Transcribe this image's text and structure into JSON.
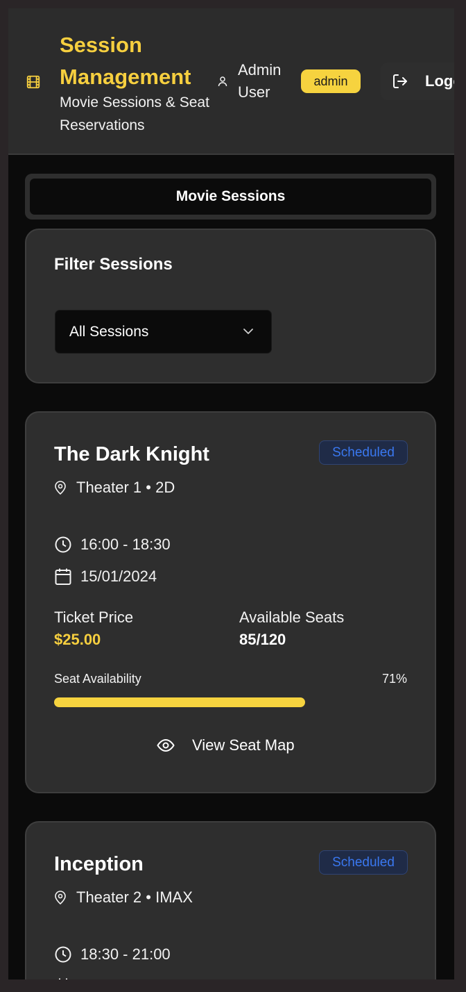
{
  "header": {
    "title": "Session Management",
    "subtitle": "Movie Sessions & Seat Reservations",
    "user_name": "Admin User",
    "role_badge": "admin",
    "logout_label": "Logout"
  },
  "tabs": [
    {
      "label": "Movie Sessions",
      "active": true
    }
  ],
  "filter": {
    "title": "Filter Sessions",
    "selected": "All Sessions"
  },
  "sessions": [
    {
      "title": "The Dark Knight",
      "status": "Scheduled",
      "location": "Theater 1 • 2D",
      "time": "16:00 - 18:30",
      "date": "15/01/2024",
      "price_label": "Ticket Price",
      "price": "$25.00",
      "seats_label": "Available Seats",
      "seats": "85/120",
      "availability_label": "Seat Availability",
      "availability_pct": "71%",
      "availability_fraction": 0.71,
      "view_label": "View Seat Map"
    },
    {
      "title": "Inception",
      "status": "Scheduled",
      "location": "Theater 2 • IMAX",
      "time": "18:30 - 21:00"
    }
  ],
  "colors": {
    "accent": "#f6cf3f",
    "status_blue": "#3a78f0",
    "card_bg": "#2e2e2e",
    "page_bg": "#0b0b0b"
  },
  "icons": {
    "brand": "film-icon",
    "user": "user-icon",
    "logout": "logout-icon",
    "dropdown": "chevron-down-icon",
    "location": "map-pin-icon",
    "time": "clock-icon",
    "date": "calendar-icon",
    "view": "eye-icon"
  }
}
